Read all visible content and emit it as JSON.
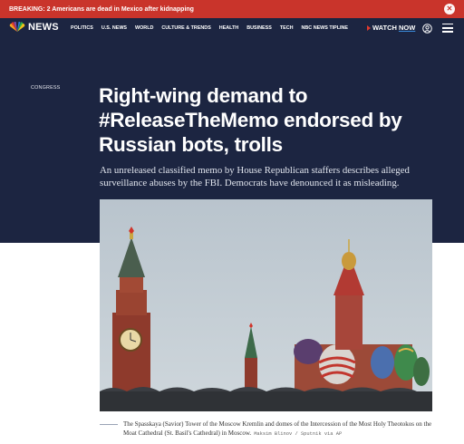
{
  "breaking": {
    "text": "BREAKING: 2 Americans are dead in Mexico after kidnapping"
  },
  "nav": {
    "logo": "NEWS",
    "links": [
      "POLITICS",
      "U.S. NEWS",
      "WORLD",
      "CULTURE & TRENDS",
      "HEALTH",
      "BUSINESS",
      "TECH",
      "NBC NEWS TIPLINE"
    ],
    "watch_label": "WATCH",
    "watch_now": "NOW"
  },
  "article": {
    "section": "CONGRESS",
    "headline": "Right-wing demand to #ReleaseTheMemo endorsed by Russian bots, trolls",
    "dek": "An unreleased classified memo by House Republican staffers describes alleged surveillance abuses by the FBI. Democrats have denounced it as misleading.",
    "caption": "The Spasskaya (Savior) Tower of the Moscow Kremlin and domes of the Intercession of the Most Holy Theotokos on the Moat Cathedral (St. Basil's Cathedral) in Moscow.",
    "credit": "Maksim Blinov / Sputnik via AP"
  },
  "colors": {
    "banner": "#c9342b",
    "navy": "#1c2541",
    "accent_blue": "#3a8dde"
  },
  "icons": [
    "close-icon",
    "peacock-logo-icon",
    "play-icon",
    "user-icon",
    "menu-icon"
  ]
}
